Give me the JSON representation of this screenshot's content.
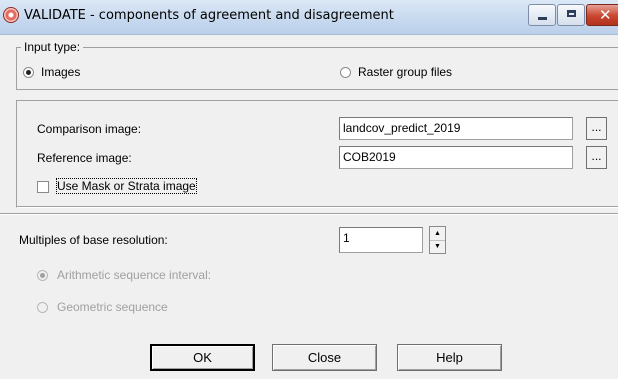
{
  "window": {
    "title": "VALIDATE - components of agreement and disagreement",
    "icon": "idrisi-app-icon",
    "controls": {
      "minimize": "minimize-icon",
      "maximize": "maximize-icon",
      "close": "close-icon"
    }
  },
  "input_type": {
    "legend": "Input type:",
    "options": [
      {
        "label": "Images",
        "selected": true
      },
      {
        "label": "Raster group files",
        "selected": false
      }
    ]
  },
  "files": {
    "comparison": {
      "label": "Comparison image:",
      "value": "landcov_predict_2019",
      "browse": "..."
    },
    "reference": {
      "label": "Reference image:",
      "value": "COB2019",
      "browse": "..."
    },
    "mask": {
      "label": "Use Mask or Strata image",
      "checked": false
    }
  },
  "resolution": {
    "label": "Multiples of base resolution:",
    "value": "1"
  },
  "sequence": {
    "options": [
      {
        "label": "Arithmetic sequence interval:",
        "selected": true,
        "disabled": true
      },
      {
        "label": "Geometric sequence",
        "selected": false,
        "disabled": true
      }
    ]
  },
  "buttons": {
    "ok": "OK",
    "close": "Close",
    "help": "Help"
  }
}
